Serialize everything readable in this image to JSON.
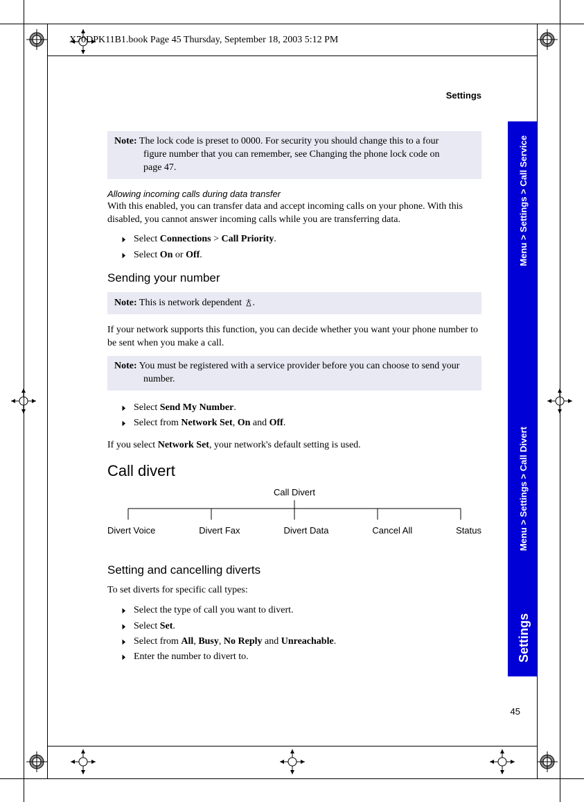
{
  "crop_header": "X70DPK11B1.book  Page 45  Thursday, September 18, 2003  5:12 PM",
  "running_head": "Settings",
  "note1_label": "Note:",
  "note1_line1": " The lock code is preset to 0000. For security you should change this to a four",
  "note1_line2": "figure number that you can remember, see Changing the phone lock code on",
  "note1_line3": "page 47.",
  "subhead1": "Allowing incoming calls during data transfer",
  "para1": "With this enabled, you can transfer data and accept incoming calls on your phone. With this disabled, you cannot answer incoming calls while you are transferring data.",
  "bullet1a_pre": "Select ",
  "bullet1a_b1": "Connections",
  "bullet1a_mid": " > ",
  "bullet1a_b2": "Call Priority",
  "bullet1a_post": ".",
  "bullet1b_pre": "Select ",
  "bullet1b_b1": "On",
  "bullet1b_mid": " or ",
  "bullet1b_b2": "Off",
  "bullet1b_post": ".",
  "h2_send": "Sending your number",
  "note2_label": "Note:",
  "note2_body": " This is network dependent ",
  "note2_post": ".",
  "para2": "If your network supports this function, you can decide whether you want your phone number to be sent when you make a call.",
  "note3_label": "Note:",
  "note3_line1": " You must be registered with a service provider before you can choose to send your",
  "note3_line2": "number.",
  "bullet2a_pre": "Select ",
  "bullet2a_b1": "Send My Number",
  "bullet2a_post": ".",
  "bullet2b_pre": "Select from ",
  "bullet2b_b1": "Network Set",
  "bullet2b_c1": ", ",
  "bullet2b_b2": "On",
  "bullet2b_c2": " and ",
  "bullet2b_b3": "Off",
  "bullet2b_post": ".",
  "para3_pre": "If you select ",
  "para3_b": "Network Set",
  "para3_post": ", your network's default setting is used.",
  "h1_divert": "Call divert",
  "diag_title": "Call Divert",
  "diag_items": [
    "Divert Voice",
    "Divert Fax",
    "Divert Data",
    "Cancel All",
    "Status"
  ],
  "h2_setting": "Setting and cancelling diverts",
  "para4": "To set diverts for specific call types:",
  "bullet3a": "Select the type of call you want to divert.",
  "bullet3b_pre": "Select ",
  "bullet3b_b": "Set",
  "bullet3b_post": ".",
  "bullet3c_pre": "Select from ",
  "bullet3c_b1": "All",
  "bullet3c_c1": ", ",
  "bullet3c_b2": "Busy",
  "bullet3c_c2": ", ",
  "bullet3c_b3": "No Reply",
  "bullet3c_c3": " and ",
  "bullet3c_b4": "Unreachable",
  "bullet3c_post": ".",
  "bullet3d": "Enter the number to divert to.",
  "side_top": "Menu > Settings > Call Service",
  "side_mid": "Menu > Settings > Call Divert",
  "side_main": "Settings",
  "page_number": "45"
}
